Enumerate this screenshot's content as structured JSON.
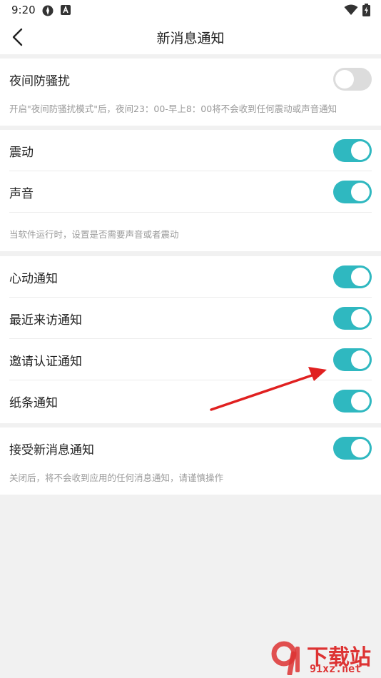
{
  "status_bar": {
    "time": "9:20"
  },
  "header": {
    "title": "新消息通知"
  },
  "groups": [
    {
      "rows": [
        {
          "label": "夜间防骚扰",
          "on": false
        }
      ],
      "hint": "开启\"夜间防骚扰模式\"后，夜间23：00-早上8：00将不会收到任何震动或声音通知"
    },
    {
      "rows": [
        {
          "label": "震动",
          "on": true
        },
        {
          "label": "声音",
          "on": true
        }
      ],
      "hint": "当软件运行时，设置是否需要声音或者震动"
    },
    {
      "rows": [
        {
          "label": "心动通知",
          "on": true
        },
        {
          "label": "最近来访通知",
          "on": true
        },
        {
          "label": "邀请认证通知",
          "on": true
        },
        {
          "label": "纸条通知",
          "on": true
        }
      ]
    },
    {
      "rows": [
        {
          "label": "接受新消息通知",
          "on": true
        }
      ],
      "hint": "关闭后，将不会收到应用的任何消息通知，请谨慎操作"
    }
  ],
  "watermark": {
    "line1": "下载站",
    "line2": "91xz.net"
  },
  "colors": {
    "toggle_on": "#2fb8c0",
    "toggle_off": "#dcdcdc",
    "arrow": "#e02020"
  }
}
